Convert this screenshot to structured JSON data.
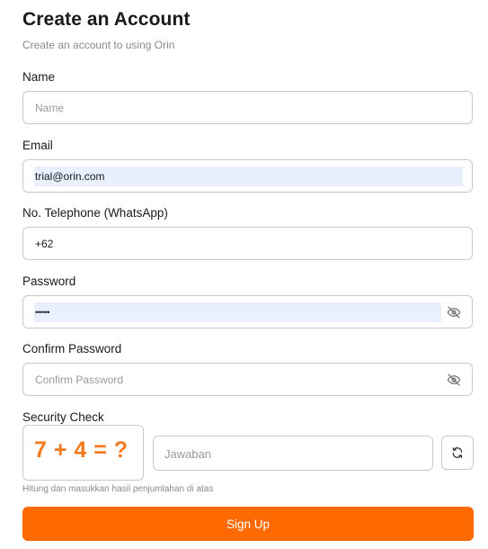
{
  "header": {
    "title": "Create an Account",
    "subtitle": "Create an account to using Orin"
  },
  "form": {
    "name": {
      "label": "Name",
      "value": "",
      "placeholder": "Name"
    },
    "email": {
      "label": "Email",
      "value": "trial@orin.com",
      "placeholder": ""
    },
    "phone": {
      "label": "No. Telephone (WhatsApp)",
      "value": "+62",
      "placeholder": ""
    },
    "password": {
      "label": "Password",
      "value": "••••••",
      "placeholder": "",
      "toggle_icon": "eye-off-icon"
    },
    "confirm_password": {
      "label": "Confirm Password",
      "value": "",
      "placeholder": "Confirm Password",
      "toggle_icon": "eye-off-icon"
    },
    "security": {
      "label": "Security Check",
      "question": "7 + 4 = ?",
      "answer_placeholder": "Jawaban",
      "refresh_icon": "refresh-icon",
      "hint": "Hitung dan masukkan hasil penjumlahan di atas"
    },
    "submit_label": "Sign Up"
  },
  "colors": {
    "accent": "#ff6a00",
    "captcha_text": "#f47a1f",
    "autofill_bg": "#e8f0fe",
    "border": "#c9c9c9"
  }
}
